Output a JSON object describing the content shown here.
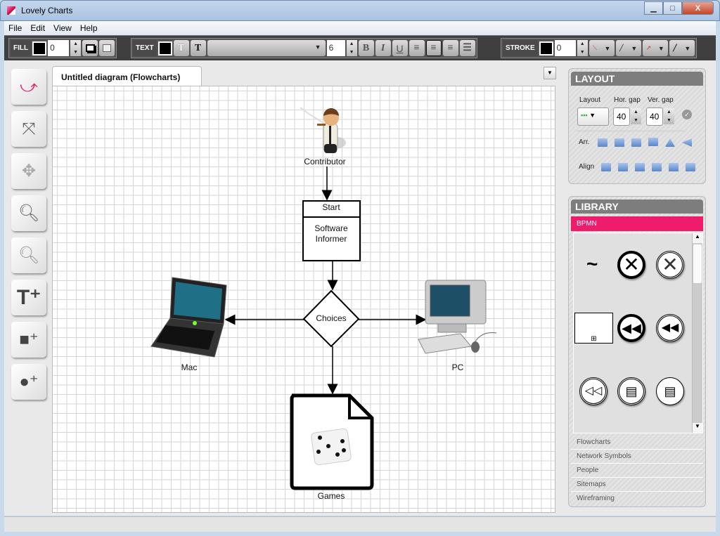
{
  "window": {
    "title": "Lovely Charts",
    "minimize": "▁",
    "maximize": "□",
    "close": "X"
  },
  "menu": [
    "File",
    "Edit",
    "View",
    "Help"
  ],
  "toolbar": {
    "fill": {
      "label": "FILL",
      "color": "#000000",
      "value": "0"
    },
    "text": {
      "label": "TEXT",
      "color": "#000000",
      "font": "",
      "size": "6",
      "buttons": [
        "T",
        "T",
        "B",
        "I",
        "U"
      ]
    },
    "stroke": {
      "label": "STROKE",
      "color": "#000000",
      "value": "0"
    }
  },
  "tools": [
    "hand-paint-icon",
    "pointer-move-icon",
    "pan-icon",
    "zoom-in-icon",
    "zoom-out-icon",
    "add-text-icon",
    "add-shape-icon",
    "add-circle-icon"
  ],
  "tab": {
    "title": "Untitled diagram (Flowcharts)"
  },
  "diagram": {
    "contributor": "Contributor",
    "start_header": "Start",
    "start_body": [
      "Software",
      "Informer"
    ],
    "decision": "Choices",
    "mac": "Mac",
    "pc": "PC",
    "games": "Games"
  },
  "layout": {
    "title": "LAYOUT",
    "layout_label": "Layout",
    "hgap_label": "Hor. gap",
    "vgap_label": "Ver. gap",
    "hgap": "40",
    "vgap": "40",
    "arr_label": "Arr.",
    "align_label": "Align"
  },
  "library": {
    "title": "LIBRARY",
    "active": "BPMN",
    "accent": "#ee1c6a",
    "categories": [
      "Flowcharts",
      "Network Symbols",
      "People",
      "Sitemaps",
      "Wireframing"
    ],
    "tilde": "~"
  }
}
